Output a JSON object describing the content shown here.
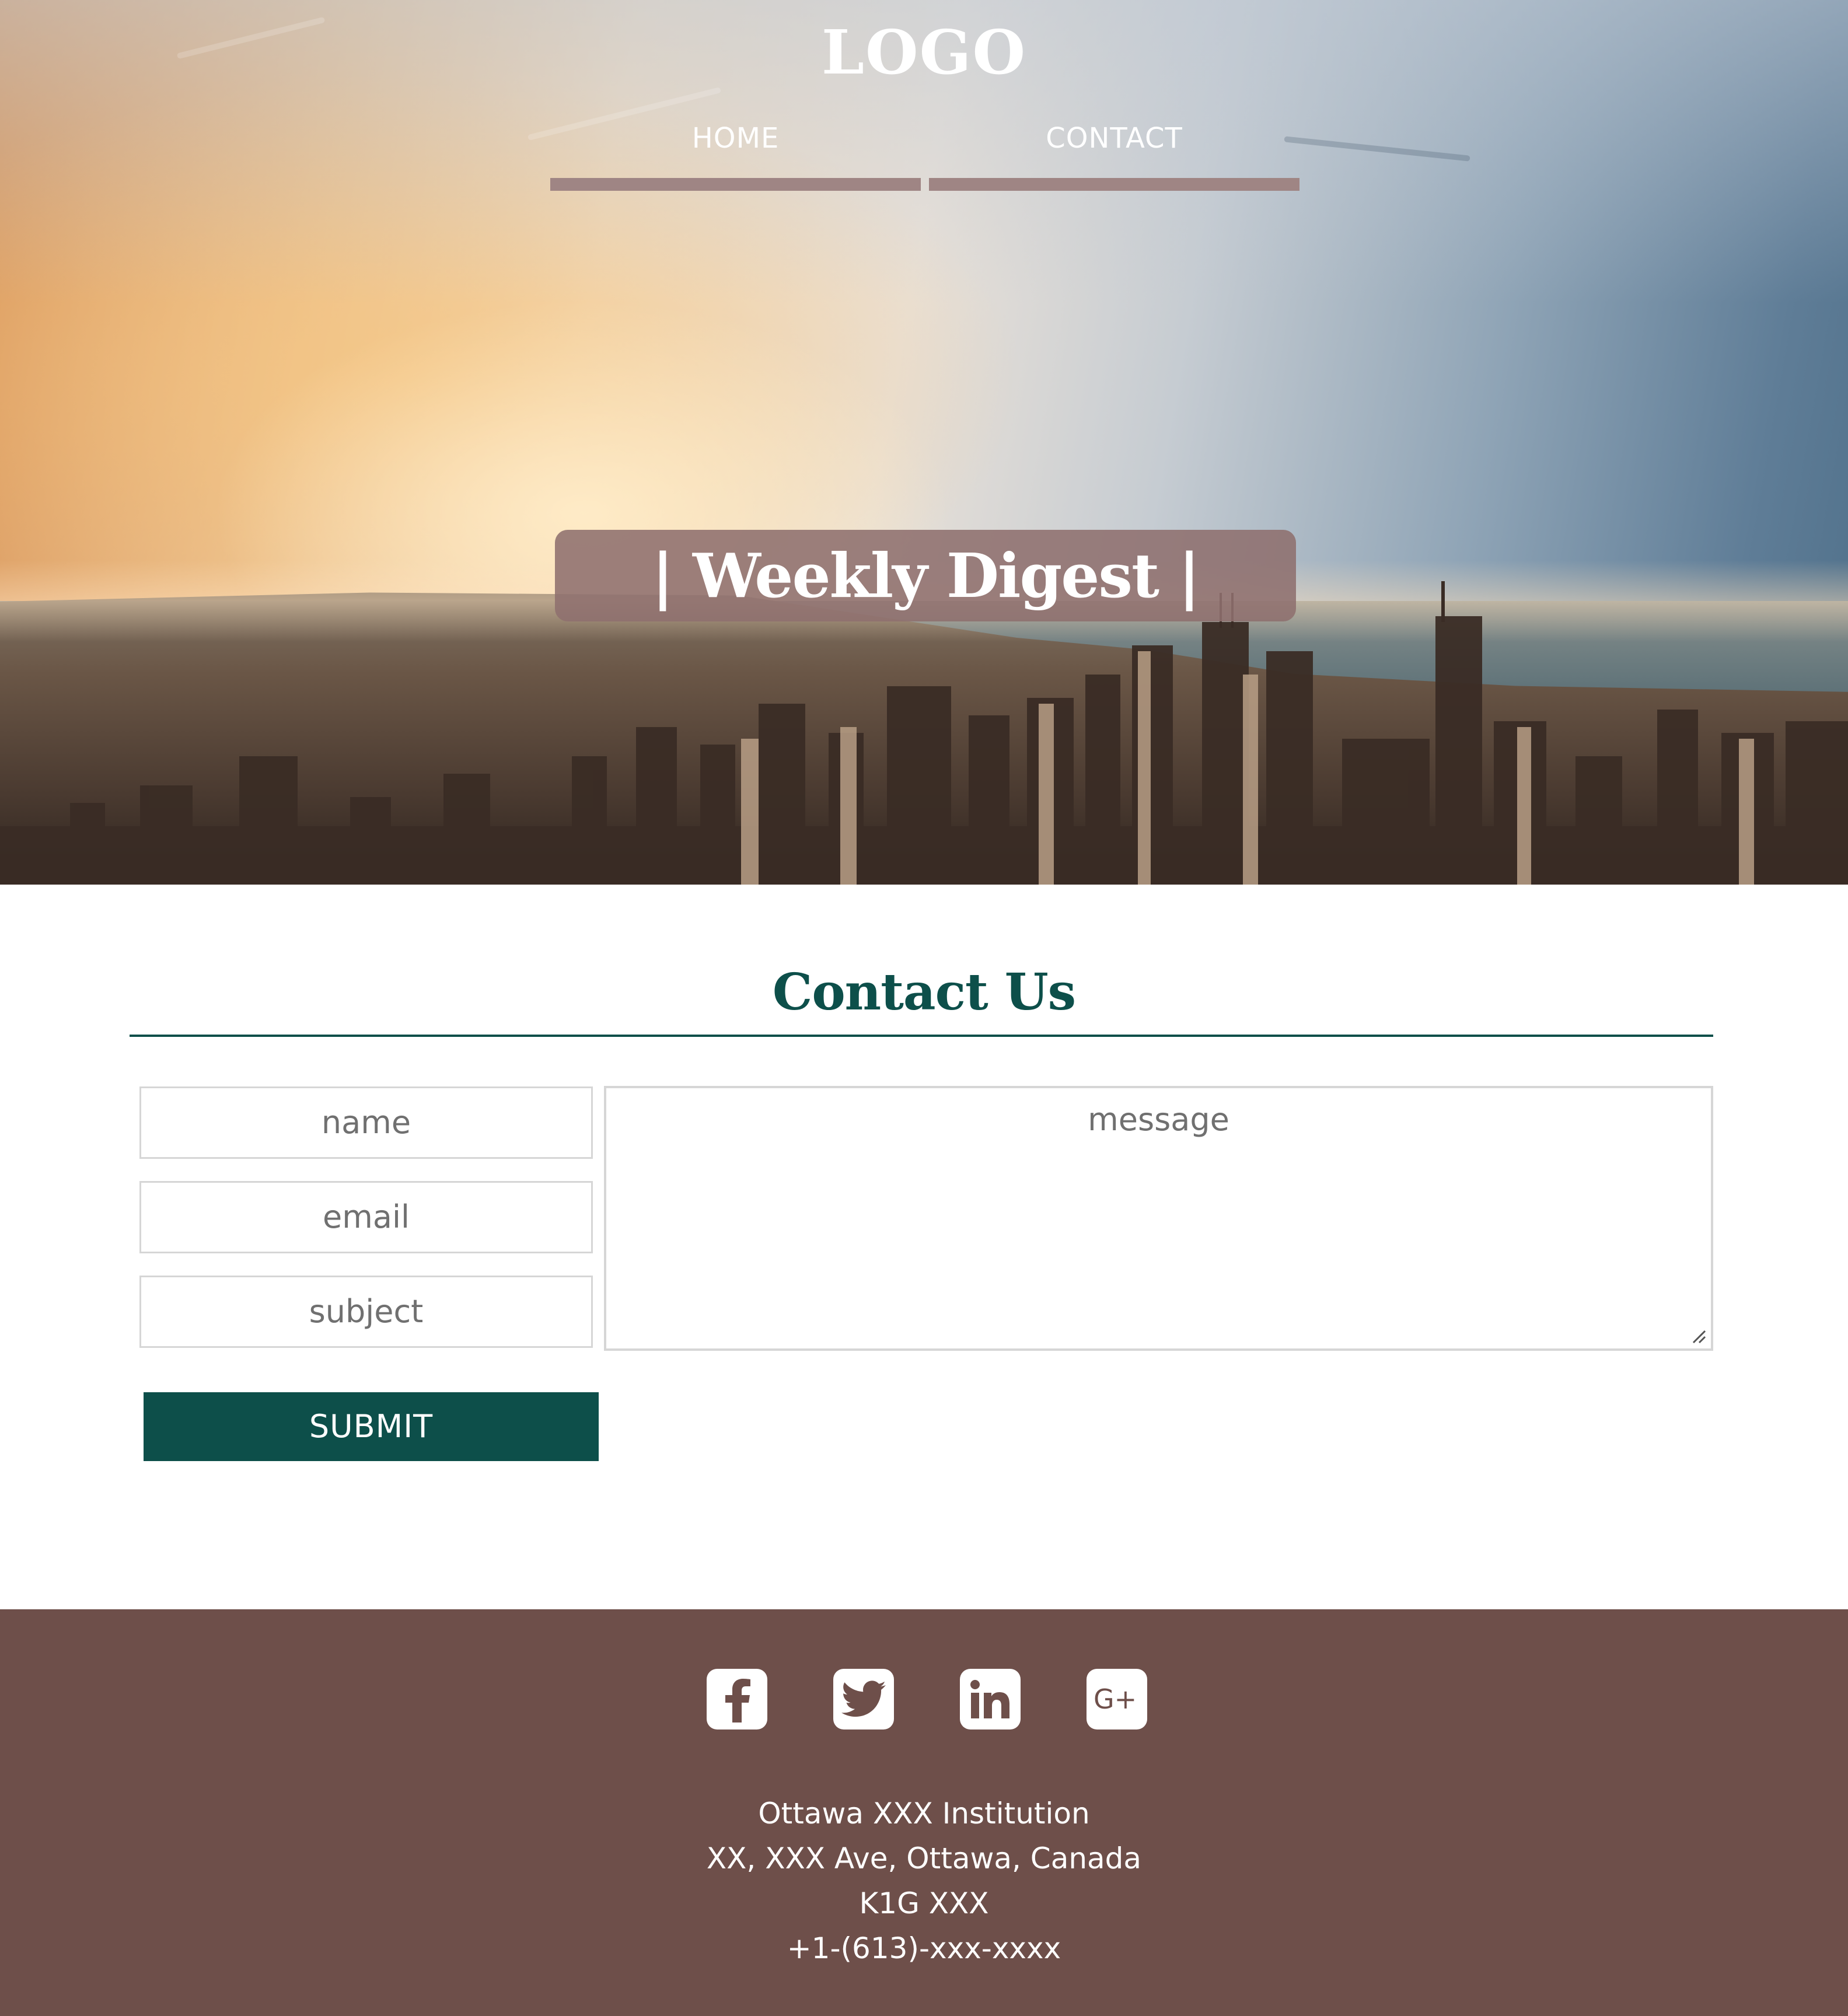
{
  "header": {
    "logo": "LOGO",
    "nav": [
      {
        "label": "HOME"
      },
      {
        "label": "CONTACT"
      }
    ],
    "banner_title": "| Weekly Digest |"
  },
  "contact": {
    "title": "Contact Us",
    "fields": {
      "name_placeholder": "name",
      "email_placeholder": "email",
      "subject_placeholder": "subject",
      "message_placeholder": "message"
    },
    "submit_label": "SUBMIT"
  },
  "footer": {
    "social": [
      {
        "icon": "facebook-icon"
      },
      {
        "icon": "twitter-icon"
      },
      {
        "icon": "linkedin-icon"
      },
      {
        "icon": "google-plus-icon",
        "text": "G+"
      }
    ],
    "address": {
      "line1": "Ottawa XXX Institution",
      "line2": "XX, XXX Ave, Ottawa, Canada",
      "line3": "K1G XXX",
      "phone": "+1-(613)-xxx-xxxx"
    }
  },
  "colors": {
    "accent": "#0d4f4a",
    "footer_bg": "#6e4f4a",
    "nav_bar": "#9f8584",
    "banner_bg": "#8e706e"
  }
}
